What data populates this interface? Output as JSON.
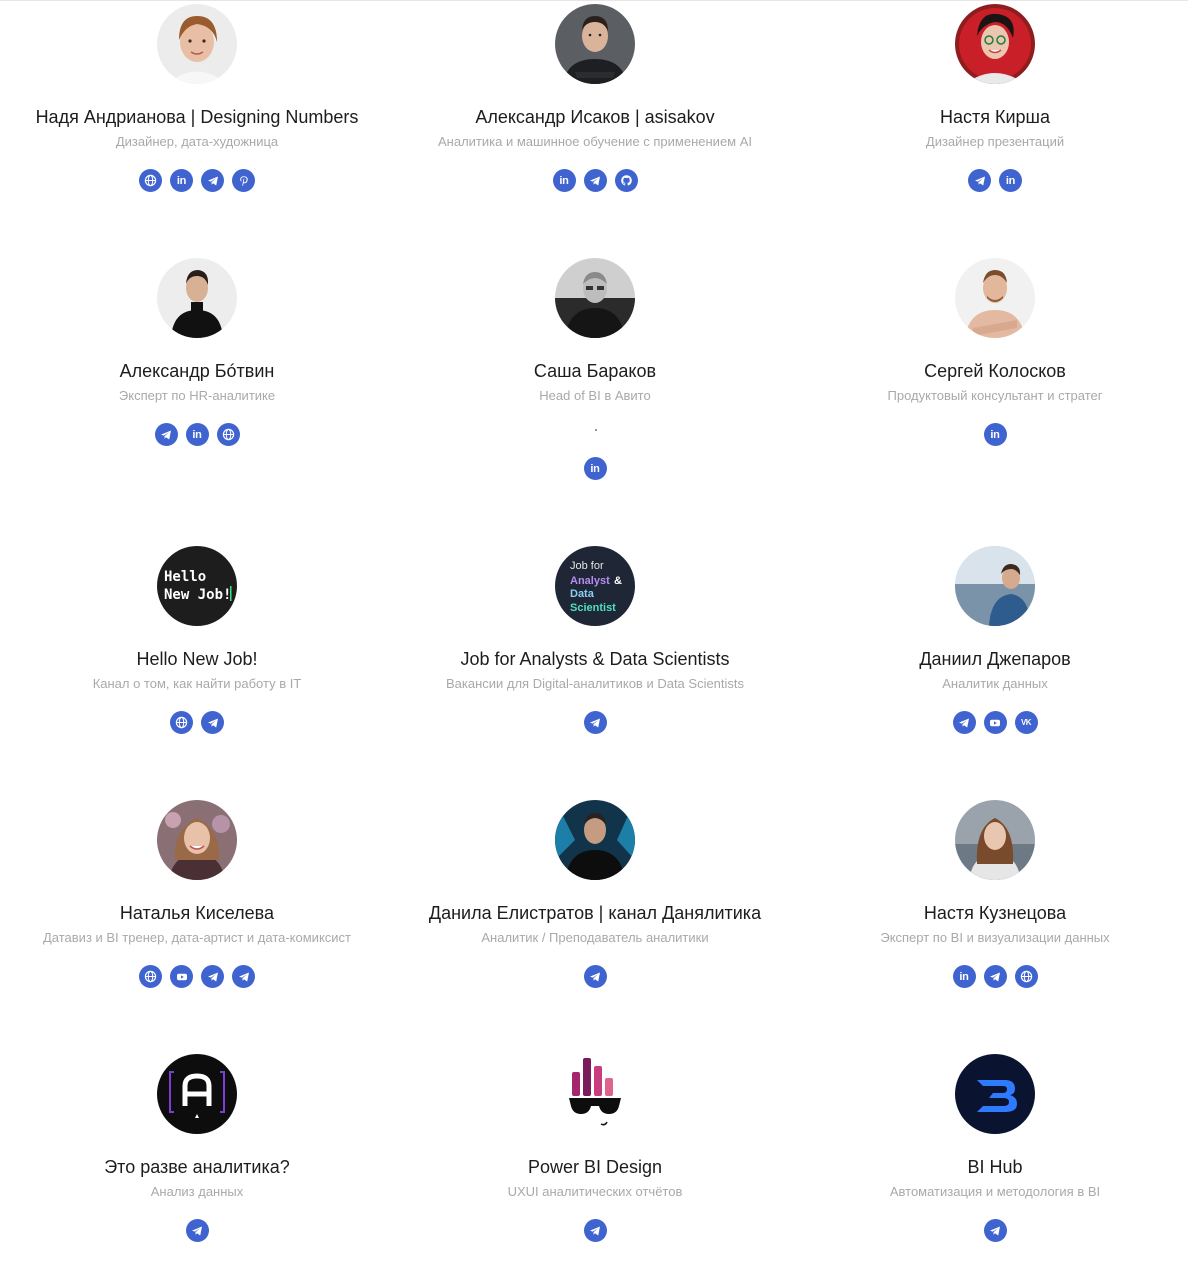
{
  "people": [
    {
      "name": "Надя Андрианова | Designing Numbers",
      "desc": "Дизайнер, дата-художница",
      "links": [
        "web",
        "linkedin",
        "telegram",
        "pinterest"
      ]
    },
    {
      "name": "Александр Исаков | asisakov",
      "desc": "Аналитика и машинное обучение с применением AI",
      "links": [
        "linkedin",
        "telegram",
        "github"
      ]
    },
    {
      "name": "Настя Кирша",
      "desc": "Дизайнер презентаций",
      "links": [
        "telegram",
        "linkedin"
      ]
    },
    {
      "name": "Александр Бóтвин",
      "desc": "Эксперт по HR-аналитике",
      "links": [
        "telegram",
        "linkedin",
        "web"
      ]
    },
    {
      "name": "Саша Бараков",
      "desc": "Head of BI в Авито",
      "links": [
        "linkedin"
      ]
    },
    {
      "name": "Сергей Колосков",
      "desc": "Продуктовый консультант и стратег",
      "links": [
        "linkedin"
      ]
    },
    {
      "name": "Hello New Job!",
      "desc": "Канал о том, как найти работу в IT",
      "links": [
        "web",
        "telegram"
      ],
      "logo_lines": [
        "Hello",
        "New Job!"
      ]
    },
    {
      "name": "Job for Analysts & Data Scientists",
      "desc": "Вакансии для Digital-аналитиков и Data Scientists",
      "links": [
        "telegram"
      ],
      "logo_lines": [
        "Job for",
        "Analyst",
        "&",
        "Data",
        "Scientist"
      ]
    },
    {
      "name": "Даниил Джепаров",
      "desc": "Аналитик данных",
      "links": [
        "telegram",
        "youtube",
        "vk"
      ]
    },
    {
      "name": "Наталья Киселева",
      "desc": "Датавиз и BI тренер, дата-артист и дата-комиксист",
      "links": [
        "web",
        "youtube",
        "telegram",
        "telegram"
      ]
    },
    {
      "name": "Данила Елистратов | канал Данялитика",
      "desc": "Аналитик / Преподаватель аналитики",
      "links": [
        "telegram"
      ]
    },
    {
      "name": "Настя Кузнецова",
      "desc": "Эксперт по BI и визуализации данных",
      "links": [
        "linkedin",
        "telegram",
        "web"
      ]
    },
    {
      "name": "Это разве аналитика?",
      "desc": "Анализ данных",
      "links": [
        "telegram"
      ]
    },
    {
      "name": "Power BI Design",
      "desc": "UXUI аналитических отчётов",
      "links": [
        "telegram"
      ]
    },
    {
      "name": "BI Hub",
      "desc": "Автоматизация и методология в BI",
      "links": [
        "telegram"
      ]
    }
  ],
  "colors": {
    "accent": "#3f63cf",
    "name": "#1d1d1d",
    "desc": "#a9a9a9"
  }
}
